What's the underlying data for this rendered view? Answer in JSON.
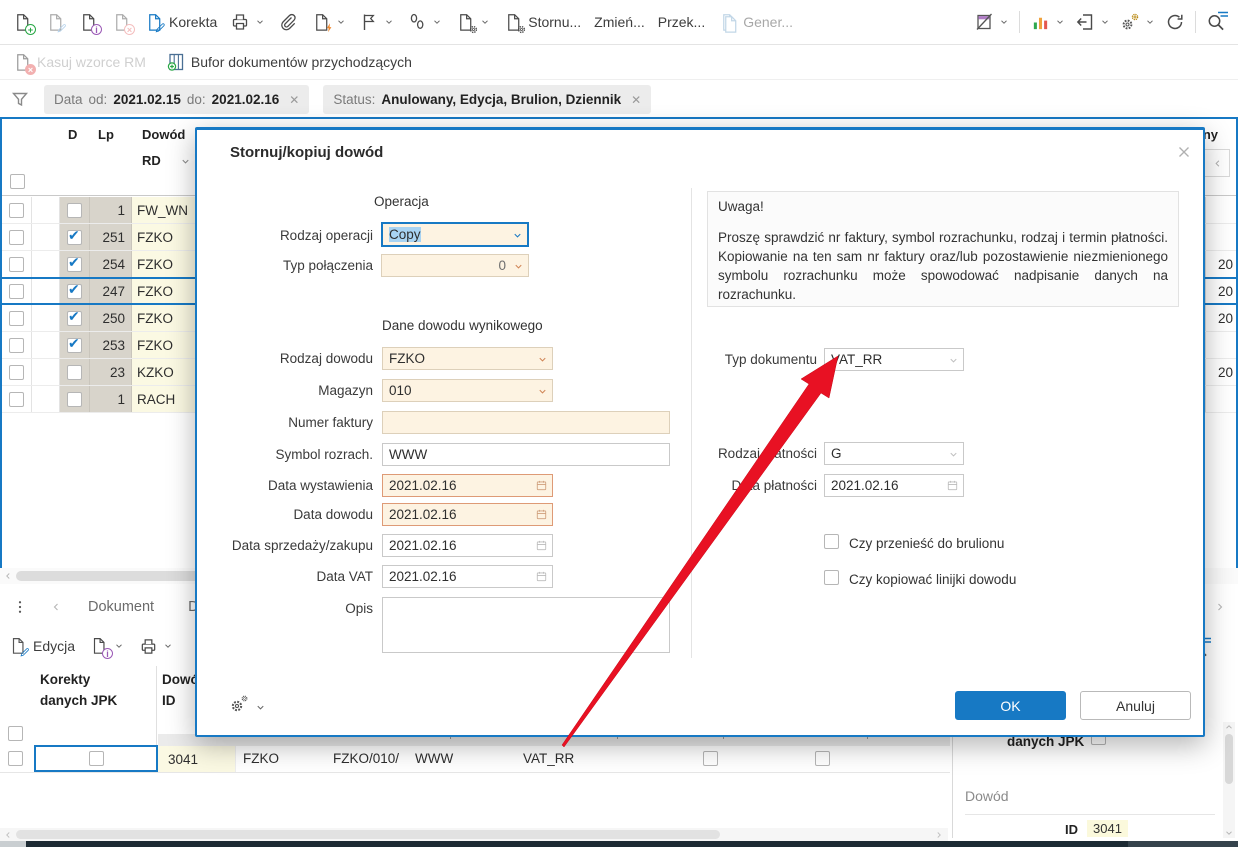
{
  "toolbar": {
    "korekta": "Korekta",
    "stornuj": "Stornu...",
    "zmien": "Zmień...",
    "przek": "Przek...",
    "gener": "Gener..."
  },
  "toolbar2": {
    "kasuj": "Kasuj wzorce RM",
    "bufor": "Bufor dokumentów przychodzących"
  },
  "filter": {
    "chip1_label": "Data",
    "chip1_from_label": "od:",
    "chip1_from": "2021.02.15",
    "chip1_to_label": "do:",
    "chip1_to": "2021.02.16",
    "chip2_label": "Status:",
    "chip2_value": "Anulowany, Edycja, Brulion, Dziennik"
  },
  "grid": {
    "col_d": "D",
    "col_lp": "Lp",
    "col_dowod": "Dowód",
    "sub_rd": "RD",
    "right_col_fragment": "ny",
    "rows": [
      {
        "lp": "1",
        "dowod": "FW_WN",
        "checked": false,
        "selected": false,
        "right": ""
      },
      {
        "lp": "251",
        "dowod": "FZKO",
        "checked": true,
        "selected": false,
        "right": ""
      },
      {
        "lp": "254",
        "dowod": "FZKO",
        "checked": true,
        "selected": false,
        "right": "20"
      },
      {
        "lp": "247",
        "dowod": "FZKO",
        "checked": true,
        "selected": true,
        "right": "20"
      },
      {
        "lp": "250",
        "dowod": "FZKO",
        "checked": true,
        "selected": false,
        "right": "20"
      },
      {
        "lp": "253",
        "dowod": "FZKO",
        "checked": true,
        "selected": false,
        "right": ""
      },
      {
        "lp": "23",
        "dowod": "KZKO",
        "checked": false,
        "selected": false,
        "right": "20"
      },
      {
        "lp": "1",
        "dowod": "RACH",
        "checked": false,
        "selected": false,
        "right": ""
      }
    ]
  },
  "bottom": {
    "tab1": "Dokument",
    "tab2": "D",
    "edycja": "Edycja",
    "header_col1_line1": "Korekty",
    "header_col1_line2": "danych JPK",
    "header_col2_line1": "Dowód",
    "header_col2_line2": "ID",
    "row": {
      "id": "3041",
      "rodzaj": "FZKO",
      "numer": "FZKO/010/",
      "symbol": "WWW",
      "typ": "VAT_RR"
    }
  },
  "side": {
    "jpk_label": "danych JPK",
    "section": "Dowód",
    "id_label": "ID",
    "id_value": "3041"
  },
  "modal": {
    "title": "Stornuj/kopiuj dowód",
    "operacja_heading": "Operacja",
    "rodzaj_operacji_label": "Rodzaj operacji",
    "rodzaj_operacji_value": "Copy",
    "typ_polaczenia_label": "Typ połączenia",
    "typ_polaczenia_value": "0",
    "dane_heading": "Dane dowodu wynikowego",
    "rodzaj_dowodu_label": "Rodzaj dowodu",
    "rodzaj_dowodu_value": "FZKO",
    "magazyn_label": "Magazyn",
    "magazyn_value": "010",
    "numer_faktury_label": "Numer faktury",
    "numer_faktury_value": "",
    "symbol_label": "Symbol rozrach.",
    "symbol_value": "WWW",
    "data_wystawienia_label": "Data wystawienia",
    "data_wystawienia_value": "2021.02.16",
    "data_dowodu_label": "Data dowodu",
    "data_dowodu_value": "2021.02.16",
    "data_sprzedazy_label": "Data sprzedaży/zakupu",
    "data_sprzedazy_value": "2021.02.16",
    "data_vat_label": "Data VAT",
    "data_vat_value": "2021.02.16",
    "opis_label": "Opis",
    "warning_title": "Uwaga!",
    "warning_text": "Proszę sprawdzić nr faktury, symbol rozrachunku, rodzaj i termin płatności. Kopiowanie na ten sam nr faktury oraz/lub pozostawienie niezmienionego symbolu rozrachunku może spowodować nadpisanie danych na rozrachunku.",
    "typ_dokumentu_label": "Typ dokumentu",
    "typ_dokumentu_value": "VAT_RR",
    "rodzaj_platnosci_label": "Rodzaj płatności",
    "rodzaj_platnosci_value": "G",
    "data_platnosci_label": "Data płatności",
    "data_platnosci_value": "2021.02.16",
    "checkbox1_label": "Czy przenieść do brulionu",
    "checkbox2_label": "Czy kopiować linijki dowodu",
    "ok": "OK",
    "anuluj": "Anuluj"
  },
  "colors": {
    "accent": "#1779c4",
    "arrow_red": "#e81123",
    "field_cream": "#fdf3e2",
    "cell_yellow": "#fbf9e3",
    "column_gray": "#d8d4cb"
  }
}
